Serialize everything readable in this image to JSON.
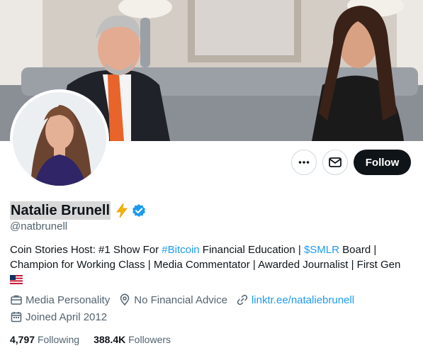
{
  "profile": {
    "display_name": "Natalie Brunell",
    "handle": "@natbrunell",
    "name_emoji": "lightning-bolt-icon",
    "verified": true,
    "accent_color": "#1d9bf0"
  },
  "actions": {
    "more_icon": "more-icon",
    "message_icon": "mail-icon",
    "follow_label": "Follow"
  },
  "bio": {
    "part1": "Coin Stories Host: #1 Show For ",
    "hashtag": "#Bitcoin",
    "part2": " Financial Education | ",
    "cashtag": "$SMLR",
    "part3": " Board | Champion for Working Class | Media Commentator | Awarded Journalist | First Gen",
    "flag": "us-flag-icon"
  },
  "meta": {
    "category": "Media Personality",
    "location": "No Financial Advice",
    "url": "linktr.ee/nataliebrunell",
    "joined": "Joined April 2012"
  },
  "stats": {
    "following_count": "4,797",
    "following_label": "Following",
    "followers_count": "388.4K",
    "followers_label": "Followers"
  }
}
